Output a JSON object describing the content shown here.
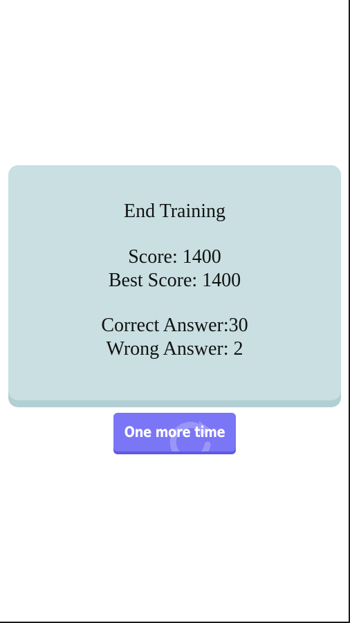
{
  "result_card": {
    "title": "End Training",
    "score": "Score: 1400",
    "best_score": "Best Score: 1400",
    "correct_answer": "Correct Answer:30",
    "wrong_answer": "Wrong Answer: 2",
    "background_color": "#c9dfe2"
  },
  "retry_button": {
    "label": "One more time",
    "icon": "refresh-icon",
    "color": "#7b76f5"
  }
}
